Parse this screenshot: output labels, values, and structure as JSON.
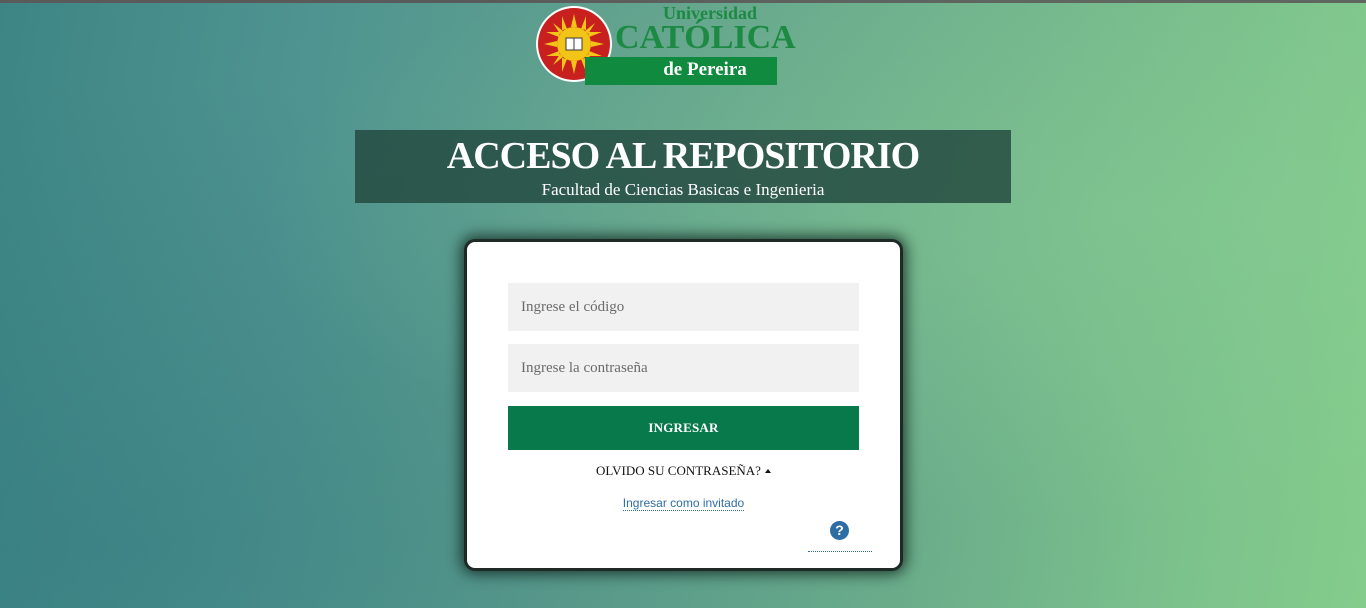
{
  "logo": {
    "line1": "Universidad",
    "line2": "CATÓLICA",
    "line3": "de Pereira",
    "brand_green": "#1c8a43",
    "seal_red": "#c8201e",
    "seal_yellow": "#f2c418"
  },
  "banner": {
    "title": "ACCESO AL REPOSITORIO",
    "subtitle": "Facultad de Ciencias Basicas e Ingenieria"
  },
  "login": {
    "code_placeholder": "Ingrese el código",
    "password_placeholder": "Ingrese la contraseña",
    "submit_label": "INGRESAR",
    "submit_color": "#07794a",
    "forgot_label": "OLVIDO SU CONTRASEÑA?",
    "guest_label": "Ingresar como invitado",
    "help_icon": "?"
  }
}
